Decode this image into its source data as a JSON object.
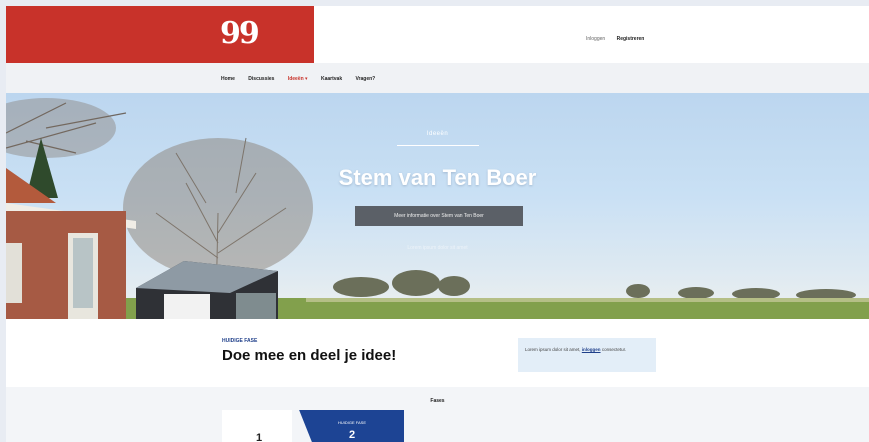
{
  "header": {
    "logo_text": "99",
    "login_label": "Inloggen",
    "register_label": "Registreren"
  },
  "nav": {
    "items": [
      {
        "label": "Home"
      },
      {
        "label": "Discussies"
      },
      {
        "label": "Ideeën ▾"
      },
      {
        "label": "Kaartvak"
      },
      {
        "label": "Vragen?"
      }
    ]
  },
  "hero": {
    "kicker": "Ideeën",
    "title": "Stem van Ten Boer",
    "button_label": "Meer informatie over Stem van Ten Boer",
    "subtext": "Lorem ipsum dolor sit amet"
  },
  "phase": {
    "label": "HUIDIGE FASE",
    "title": "Doe mee en deel je idee!",
    "info_text": "Lorem ipsum dolor sit amet,",
    "info_link": "inloggen",
    "info_text_2": "consectetur."
  },
  "phases": {
    "heading": "Fases",
    "step1_number": "1",
    "step2_label": "HUIDIGE FASE",
    "step2_number": "2"
  },
  "colors": {
    "brand_red": "#c8322a",
    "brand_blue": "#1d4494",
    "button_gray": "#5b6067"
  }
}
